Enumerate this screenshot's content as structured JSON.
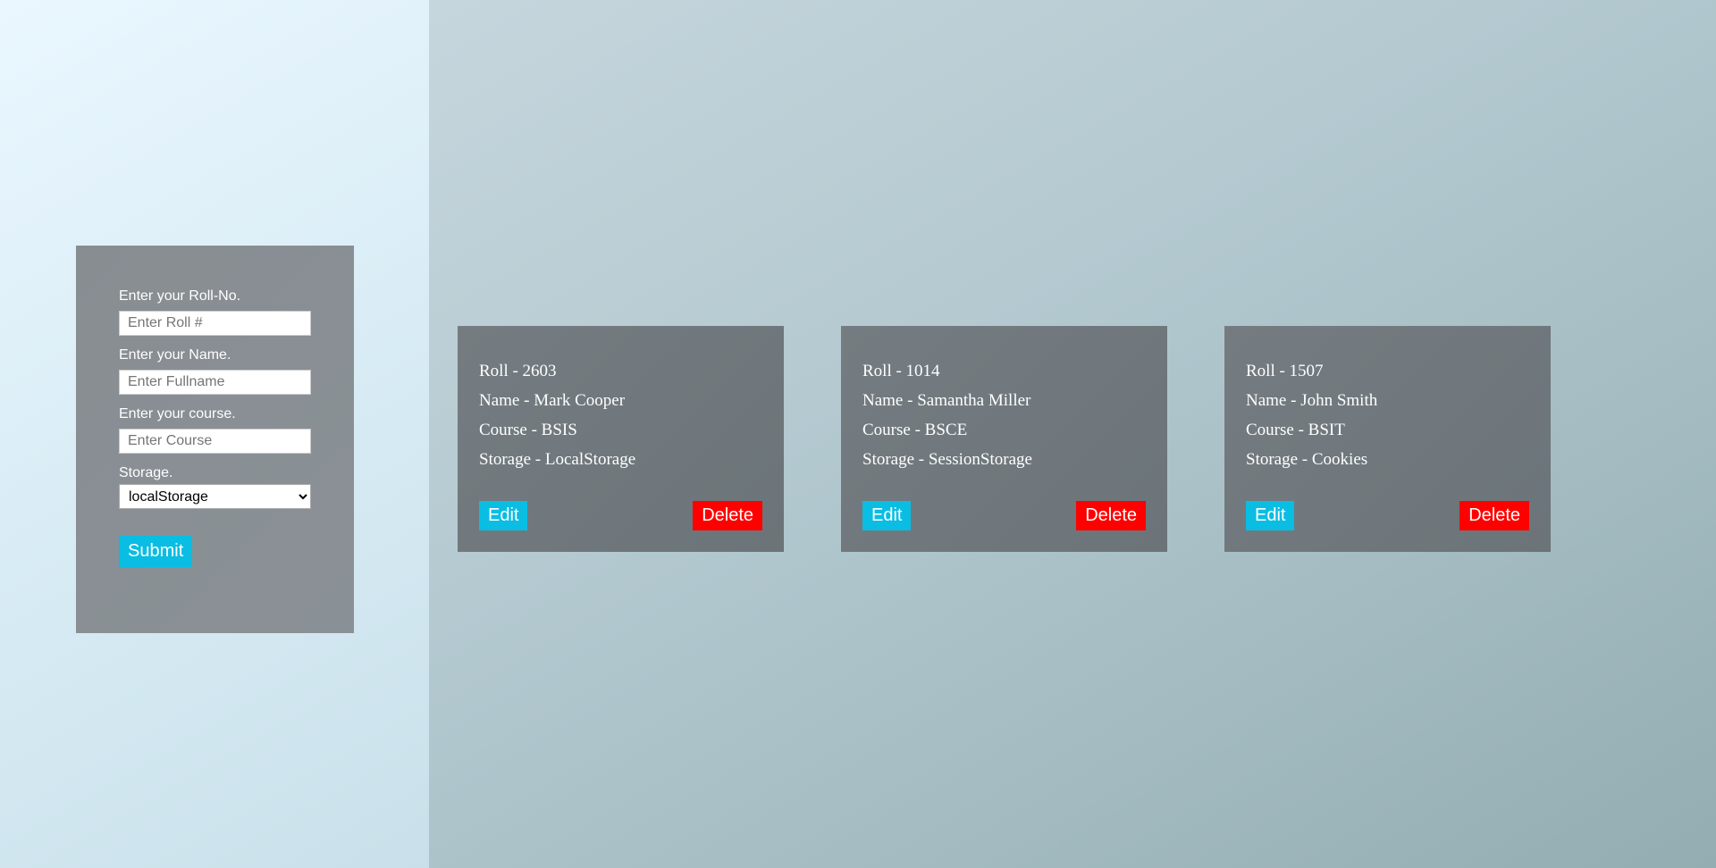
{
  "form": {
    "roll_label": "Enter your Roll-No.",
    "roll_placeholder": "Enter Roll #",
    "name_label": "Enter your Name.",
    "name_placeholder": "Enter Fullname",
    "course_label": "Enter your course.",
    "course_placeholder": "Enter Course",
    "storage_label": "Storage.",
    "storage_selected": "localStorage",
    "submit_label": "Submit"
  },
  "cards": [
    {
      "roll": "Roll - 2603",
      "name": "Name - Mark Cooper",
      "course": "Course - BSIS",
      "storage": "Storage - LocalStorage",
      "edit_label": "Edit",
      "delete_label": "Delete"
    },
    {
      "roll": "Roll - 1014",
      "name": "Name - Samantha Miller",
      "course": "Course - BSCE",
      "storage": "Storage - SessionStorage",
      "edit_label": "Edit",
      "delete_label": "Delete"
    },
    {
      "roll": "Roll - 1507",
      "name": "Name - John Smith",
      "course": "Course - BSIT",
      "storage": "Storage - Cookies",
      "edit_label": "Edit",
      "delete_label": "Delete"
    }
  ],
  "colors": {
    "accent": "#0abde3",
    "danger": "#ff0000"
  }
}
